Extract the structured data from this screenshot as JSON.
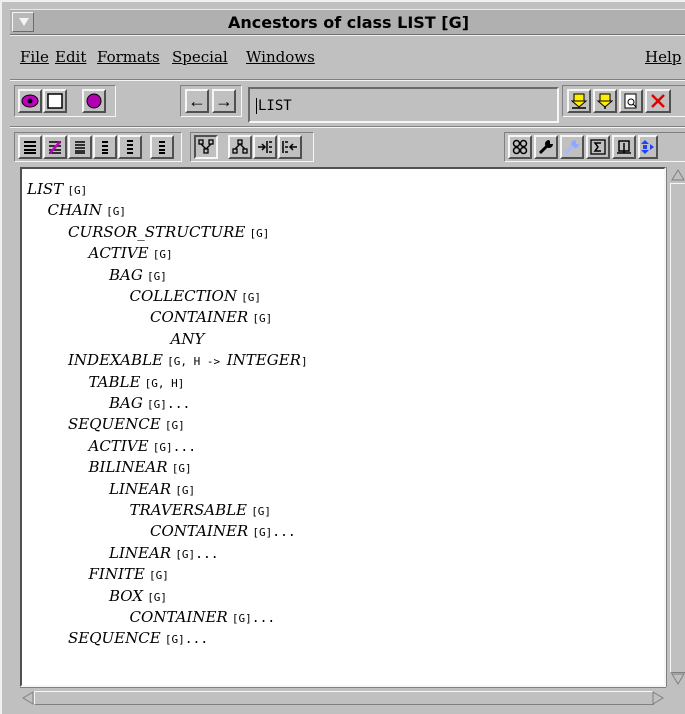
{
  "window": {
    "title": "Ancestors of class LIST [G]"
  },
  "menubar": {
    "file": "File",
    "edit": "Edit",
    "formats": "Formats",
    "special": "Special",
    "windows": "Windows",
    "help": "Help"
  },
  "toolbar": {
    "target_value": "LIST",
    "nav_back": "←",
    "nav_forward": "→",
    "status_icons": [
      "pointer-icon",
      "square-icon",
      "purple-dot-icon"
    ],
    "right_icons": [
      "yellow-drop-icon",
      "yellow-pickup-icon",
      "document-icon",
      "close-x-icon"
    ]
  },
  "format_bar": {
    "left_icons": [
      "text-format-icon",
      "flat-format-icon",
      "short-format-icon",
      "ancestors-icon",
      "descendants-icon",
      "clients-icon",
      "suppliers-icon",
      "routines-icon",
      "indent-icon",
      "outdent-icon"
    ],
    "right_icons": [
      "group-icon",
      "wrench-icon",
      "compile-icon",
      "sigma-icon",
      "step-icon",
      "next-icon"
    ]
  },
  "tree": [
    {
      "name": "LIST",
      "params": "[G]",
      "suffix": "",
      "depth": 0
    },
    {
      "name": "CHAIN",
      "params": "[G]",
      "suffix": "",
      "depth": 1
    },
    {
      "name": "CURSOR_STRUCTURE",
      "params": "[G]",
      "suffix": "",
      "depth": 2
    },
    {
      "name": "ACTIVE",
      "params": "[G]",
      "suffix": "",
      "depth": 3
    },
    {
      "name": "BAG",
      "params": "[G]",
      "suffix": "",
      "depth": 4
    },
    {
      "name": "COLLECTION",
      "params": "[G]",
      "suffix": "",
      "depth": 5
    },
    {
      "name": "CONTAINER",
      "params": "[G]",
      "suffix": "",
      "depth": 6
    },
    {
      "name": "ANY",
      "params": "",
      "suffix": "",
      "depth": 7
    },
    {
      "name": "INDEXABLE",
      "params": "[G, H -> ",
      "param2": "INTEGER",
      "params_end": "]",
      "suffix": "",
      "depth": 2
    },
    {
      "name": "TABLE",
      "params": "[G, H]",
      "suffix": "",
      "depth": 3
    },
    {
      "name": "BAG",
      "params": "[G]",
      "suffix": "...",
      "depth": 4
    },
    {
      "name": "SEQUENCE",
      "params": "[G]",
      "suffix": "",
      "depth": 2
    },
    {
      "name": "ACTIVE",
      "params": "[G]",
      "suffix": "...",
      "depth": 3
    },
    {
      "name": "BILINEAR",
      "params": "[G]",
      "suffix": "",
      "depth": 3
    },
    {
      "name": "LINEAR",
      "params": "[G]",
      "suffix": "",
      "depth": 4
    },
    {
      "name": "TRAVERSABLE",
      "params": "[G]",
      "suffix": "",
      "depth": 5
    },
    {
      "name": "CONTAINER",
      "params": "[G]",
      "suffix": "...",
      "depth": 6
    },
    {
      "name": "LINEAR",
      "params": "[G]",
      "suffix": "...",
      "depth": 4
    },
    {
      "name": "FINITE",
      "params": "[G]",
      "suffix": "",
      "depth": 3
    },
    {
      "name": "BOX",
      "params": "[G]",
      "suffix": "",
      "depth": 4
    },
    {
      "name": "CONTAINER",
      "params": "[G]",
      "suffix": "...",
      "depth": 5
    },
    {
      "name": "SEQUENCE",
      "params": "[G]",
      "suffix": "...",
      "depth": 2
    }
  ]
}
